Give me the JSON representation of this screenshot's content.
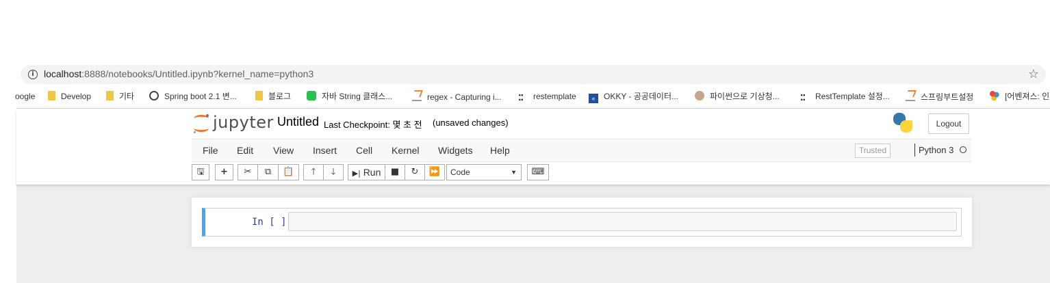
{
  "browser": {
    "url_host": "localhost",
    "url_rest": ":8888/notebooks/Untitled.ipynb?kernel_name=python3",
    "bookmarks": [
      {
        "label": "oogle",
        "icon": "none"
      },
      {
        "label": "Develop",
        "icon": "folder-icon"
      },
      {
        "label": "기타",
        "icon": "folder-icon"
      },
      {
        "label": "Spring boot 2.1 변...",
        "icon": "globe-icon"
      },
      {
        "label": "블로그",
        "icon": "folder-icon"
      },
      {
        "label": "자바 String 클래스...",
        "icon": "line-icon"
      },
      {
        "label": "regex - Capturing i...",
        "icon": "stackoverflow-icon"
      },
      {
        "label": "restemplate",
        "icon": "dots-icon"
      },
      {
        "label": "OKKY - 공공데이터...",
        "icon": "okky-icon"
      },
      {
        "label": "파이썬으로 기상청...",
        "icon": "face-icon"
      },
      {
        "label": "RestTemplate 설정...",
        "icon": "dots-icon"
      },
      {
        "label": "스프링부트설정",
        "icon": "stackoverflow-icon"
      },
      {
        "label": "[어벤져스: 인",
        "icon": "multi-icon"
      }
    ]
  },
  "header": {
    "logo_text": "jupyter",
    "notebook_name": "Untitled",
    "checkpoint": "Last Checkpoint: 몇 초 전",
    "autosave_status": "(unsaved changes)",
    "logout_label": "Logout"
  },
  "menubar": {
    "items": [
      "File",
      "Edit",
      "View",
      "Insert",
      "Cell",
      "Kernel",
      "Widgets",
      "Help"
    ],
    "trusted": "Trusted",
    "kernel": "Python 3"
  },
  "toolbar": {
    "run_label": "Run",
    "cell_type": "Code"
  },
  "cells": [
    {
      "prompt": "In [ ]:",
      "source": ""
    }
  ]
}
